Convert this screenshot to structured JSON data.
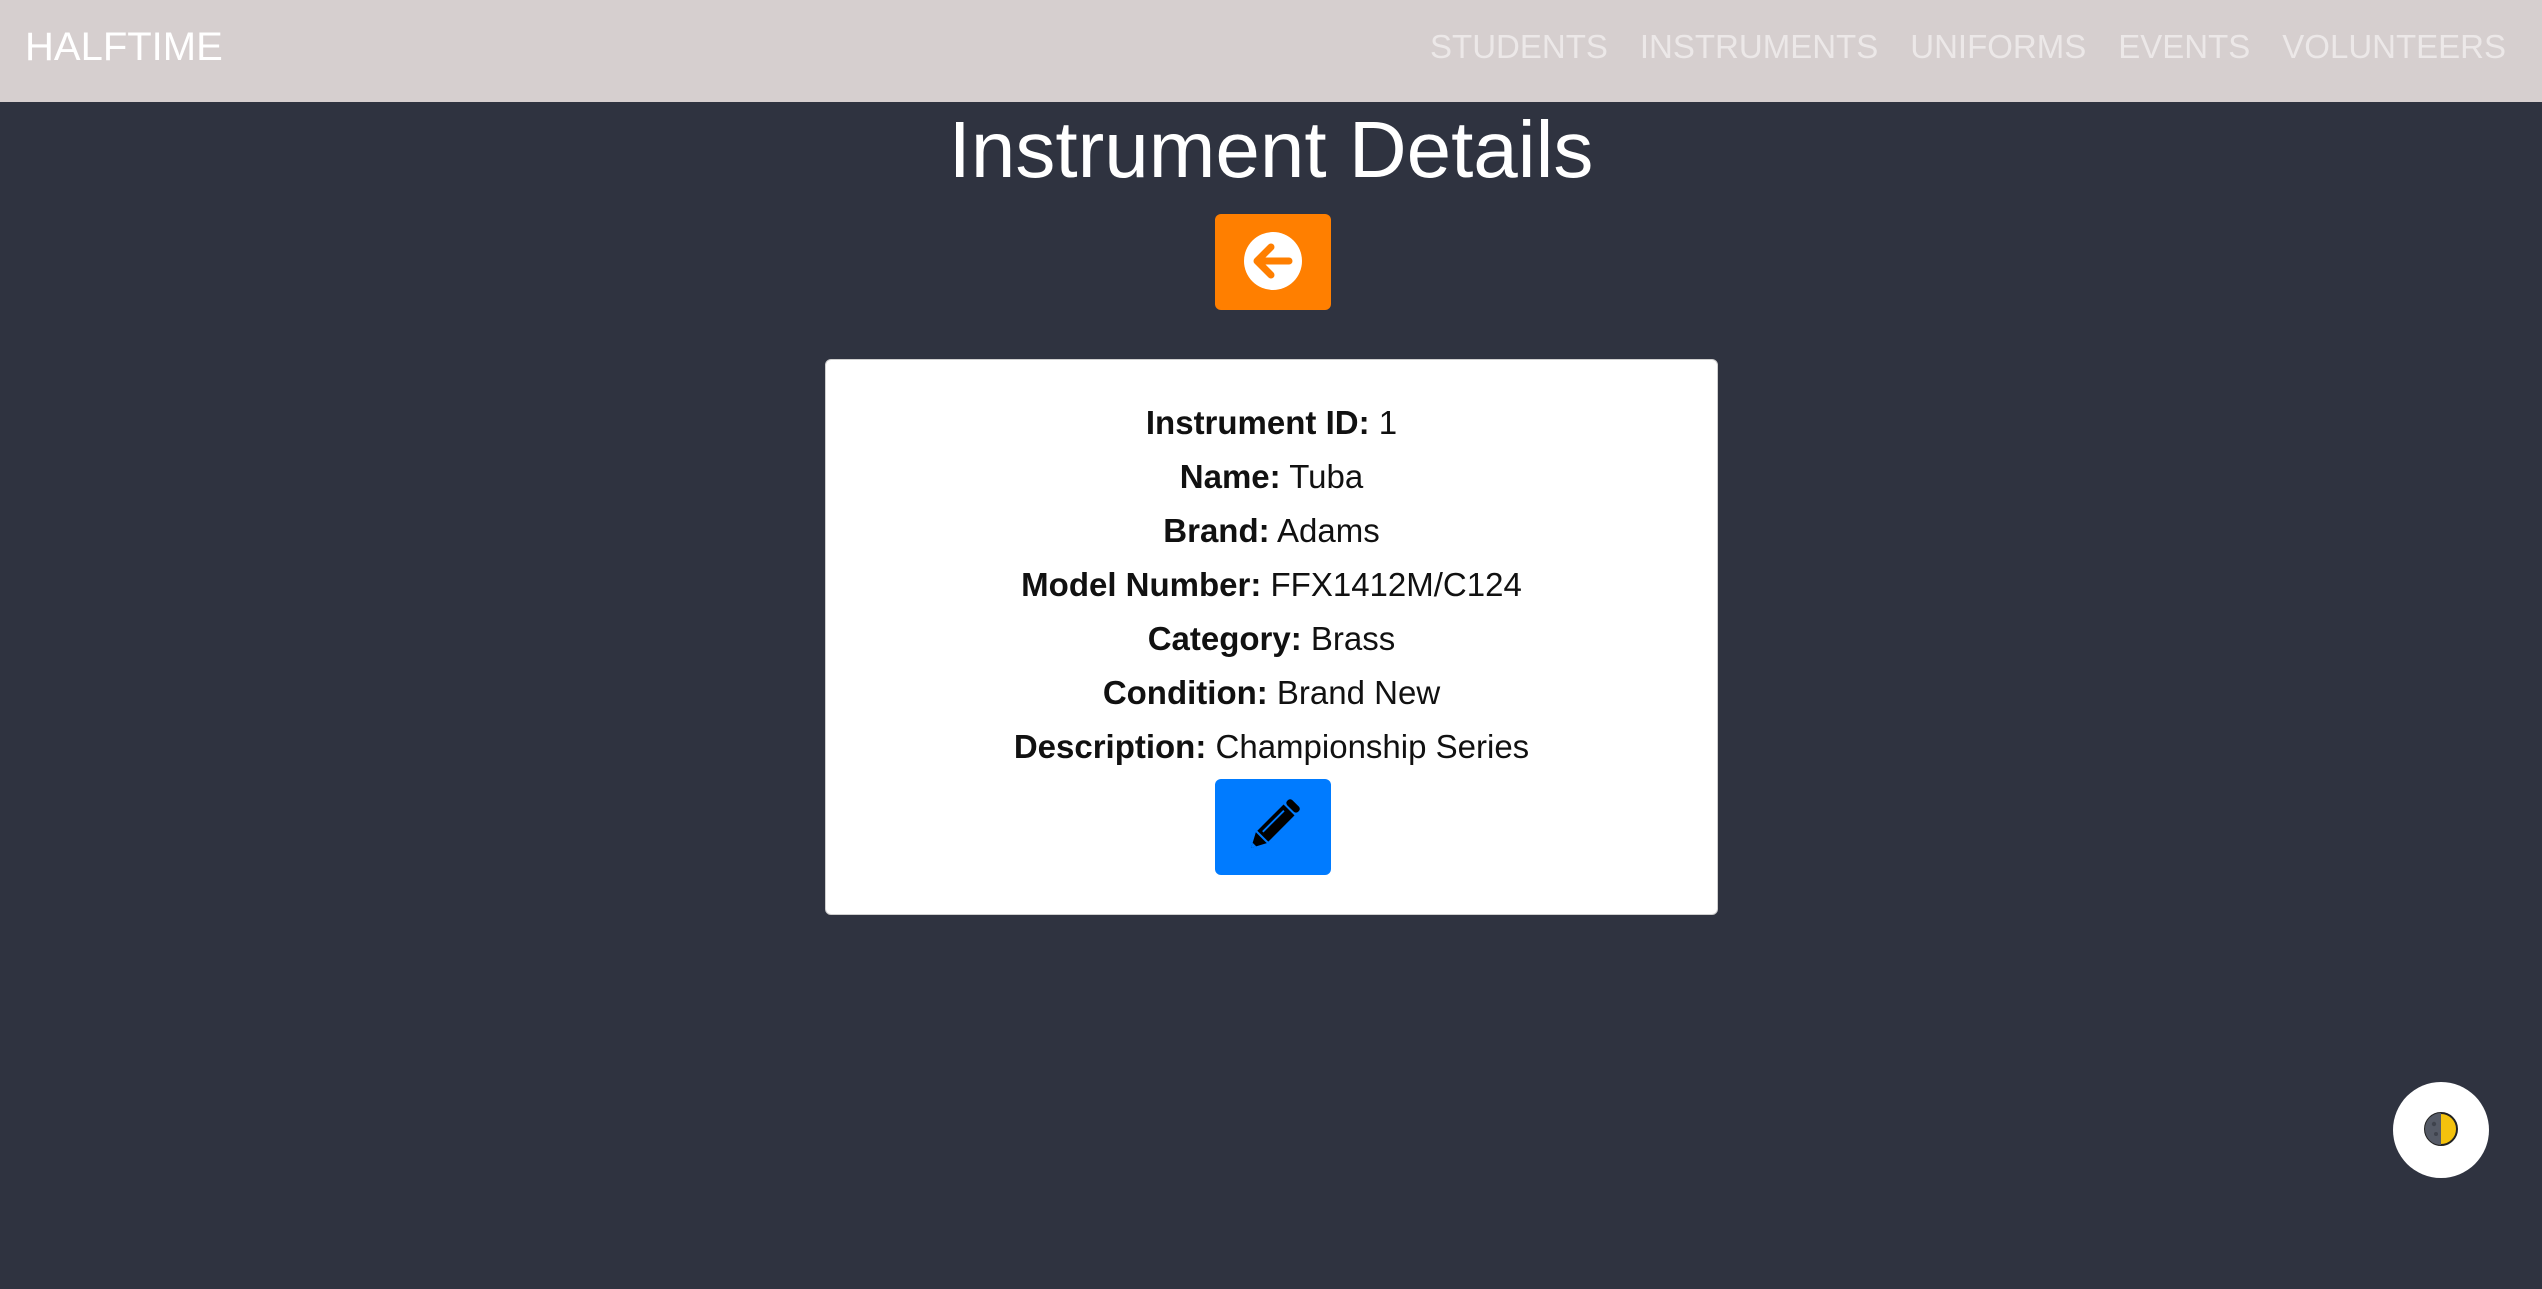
{
  "app": {
    "brand": "HALFTIME"
  },
  "nav": {
    "items": [
      {
        "label": "STUDENTS"
      },
      {
        "label": "INSTRUMENTS"
      },
      {
        "label": "UNIFORMS"
      },
      {
        "label": "EVENTS"
      },
      {
        "label": "VOLUNTEERS"
      }
    ]
  },
  "page": {
    "title": "Instrument Details",
    "back_icon": "arrow-circle-left-icon",
    "edit_icon": "pencil-icon",
    "theme_icon": "half-moon-icon"
  },
  "details": [
    {
      "label": "Instrument ID:",
      "value": "1"
    },
    {
      "label": "Name:",
      "value": "Tuba"
    },
    {
      "label": "Brand:",
      "value": "Adams"
    },
    {
      "label": "Model Number:",
      "value": "FFX1412M/C124"
    },
    {
      "label": "Category:",
      "value": "Brass"
    },
    {
      "label": "Condition:",
      "value": "Brand New"
    },
    {
      "label": "Description:",
      "value": "Championship Series"
    }
  ],
  "colors": {
    "background": "#2f3340",
    "navbar": "#d6cfcf",
    "back_button": "#ff7f00",
    "edit_button": "#007bff"
  }
}
